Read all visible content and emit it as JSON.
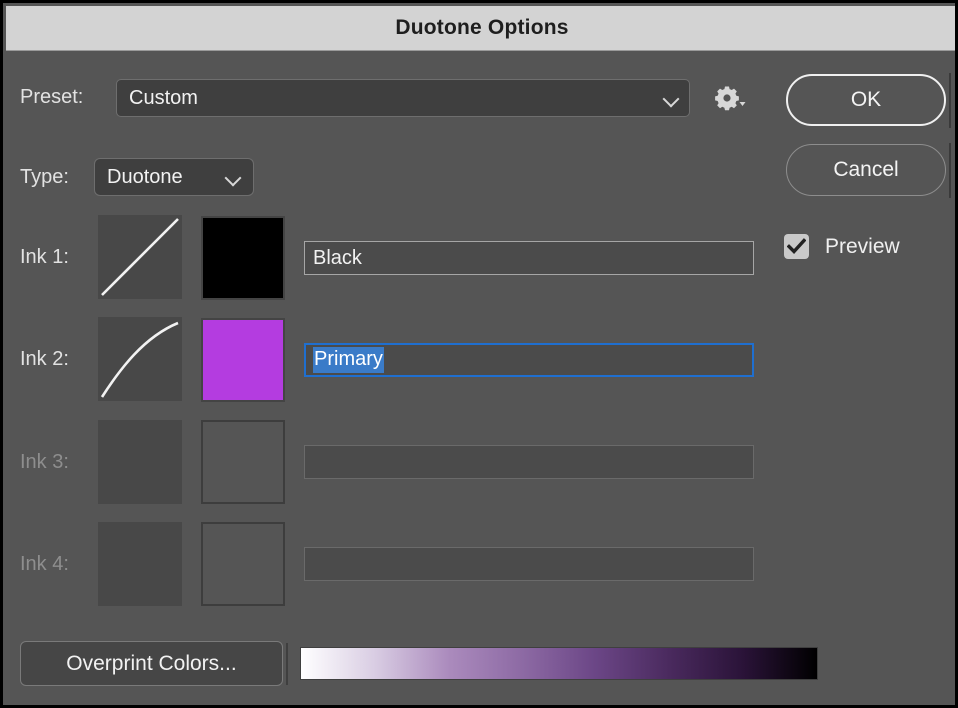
{
  "window": {
    "title": "Duotone Options"
  },
  "preset": {
    "label": "Preset:",
    "value": "Custom",
    "chevron_icon": "chevron-down-icon",
    "gear_icon": "gear-icon"
  },
  "type": {
    "label": "Type:",
    "value": "Duotone",
    "chevron_icon": "chevron-down-icon"
  },
  "buttons": {
    "ok": "OK",
    "cancel": "Cancel",
    "overprint": "Overprint Colors..."
  },
  "preview": {
    "label": "Preview",
    "checked": true,
    "check_icon": "checkmark-icon"
  },
  "inks": [
    {
      "label": "Ink 1:",
      "name": "Black",
      "color": "#000000",
      "curve": "linear",
      "enabled": true,
      "focused": false
    },
    {
      "label": "Ink 2:",
      "name": "Primary",
      "color": "#b43ce0",
      "curve": "concave-down",
      "enabled": true,
      "focused": true
    },
    {
      "label": "Ink 3:",
      "name": "",
      "color": "",
      "curve": "none",
      "enabled": false,
      "focused": false
    },
    {
      "label": "Ink 4:",
      "name": "",
      "color": "",
      "curve": "none",
      "enabled": false,
      "focused": false
    }
  ],
  "gradient": {
    "stops": [
      "#ffffff",
      "#d9cde3",
      "#ab8bbd",
      "#8d6aa4",
      "#6b4686",
      "#4a2a5e",
      "#2a1338",
      "#000000"
    ]
  },
  "colors": {
    "dialog_background": "#555555",
    "titlebar_background": "#d3d3d3",
    "accent_focus": "#1f6fd0",
    "selection_highlight": "#3a7bc8",
    "ink2_color": "#b43ce0"
  }
}
